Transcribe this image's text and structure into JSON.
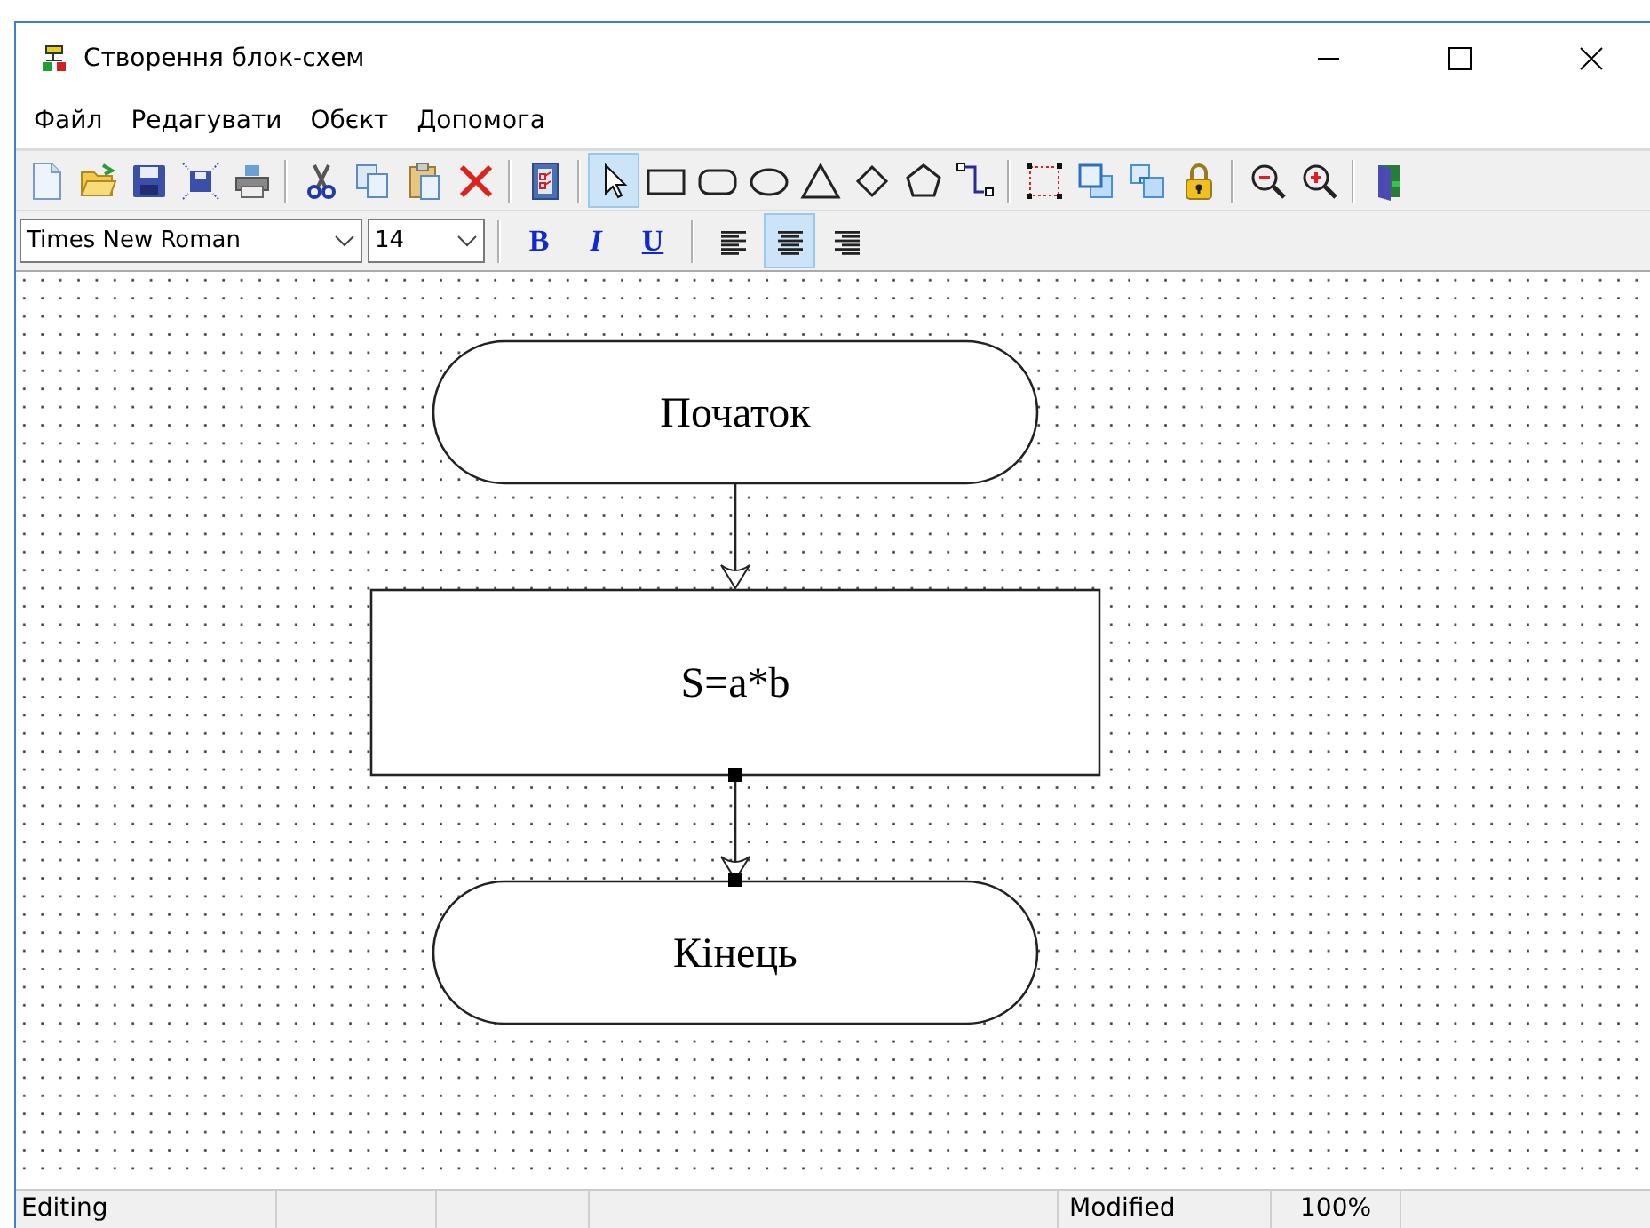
{
  "window": {
    "title": "Створення блок-схем"
  },
  "menu": [
    {
      "label": "Файл"
    },
    {
      "label": "Редагувати"
    },
    {
      "label": "Обєкт"
    },
    {
      "label": "Допомога"
    }
  ],
  "toolbar": {
    "groups": [
      [
        {
          "kind": "new",
          "selected": false
        },
        {
          "kind": "open",
          "selected": false
        },
        {
          "kind": "save",
          "selected": false
        },
        {
          "kind": "save-all",
          "selected": false
        },
        {
          "kind": "print",
          "selected": false
        }
      ],
      [
        {
          "kind": "cut",
          "selected": false
        },
        {
          "kind": "copy",
          "selected": false
        },
        {
          "kind": "paste",
          "selected": false
        },
        {
          "kind": "delete",
          "selected": false
        }
      ],
      [
        {
          "kind": "properties",
          "selected": false
        }
      ],
      [
        {
          "kind": "pointer",
          "selected": true
        },
        {
          "kind": "rectangle",
          "selected": false
        },
        {
          "kind": "rounded",
          "selected": false
        },
        {
          "kind": "ellipse",
          "selected": false
        },
        {
          "kind": "triangle",
          "selected": false
        },
        {
          "kind": "diamond",
          "selected": false
        },
        {
          "kind": "pentagon",
          "selected": false
        },
        {
          "kind": "connector",
          "selected": false
        }
      ],
      [
        {
          "kind": "select-area",
          "selected": false
        },
        {
          "kind": "front",
          "selected": false
        },
        {
          "kind": "back",
          "selected": false
        },
        {
          "kind": "lock",
          "selected": false
        }
      ],
      [
        {
          "kind": "zoom-out",
          "selected": false
        },
        {
          "kind": "zoom-in",
          "selected": false
        }
      ],
      [
        {
          "kind": "exit",
          "selected": false
        }
      ]
    ]
  },
  "format_bar": {
    "font": "Times New Roman",
    "size": "14",
    "styles": [
      {
        "kind": "bold",
        "label": "B",
        "selected": false
      },
      {
        "kind": "italic",
        "label": "I",
        "selected": false
      },
      {
        "kind": "underline",
        "label": "U",
        "selected": false
      }
    ],
    "align": [
      {
        "kind": "left",
        "selected": false
      },
      {
        "kind": "center",
        "selected": true
      },
      {
        "kind": "right",
        "selected": false
      }
    ]
  },
  "diagram": {
    "nodes": [
      {
        "kind": "terminal",
        "text": "Початок"
      },
      {
        "kind": "process",
        "text": "S=a*b"
      },
      {
        "kind": "terminal",
        "text": "Кінець"
      }
    ],
    "connectors": [
      {
        "selected": false
      },
      {
        "selected": true
      }
    ]
  },
  "status_bar": {
    "mode": "Editing",
    "state": "Modified",
    "zoom": "100%"
  }
}
